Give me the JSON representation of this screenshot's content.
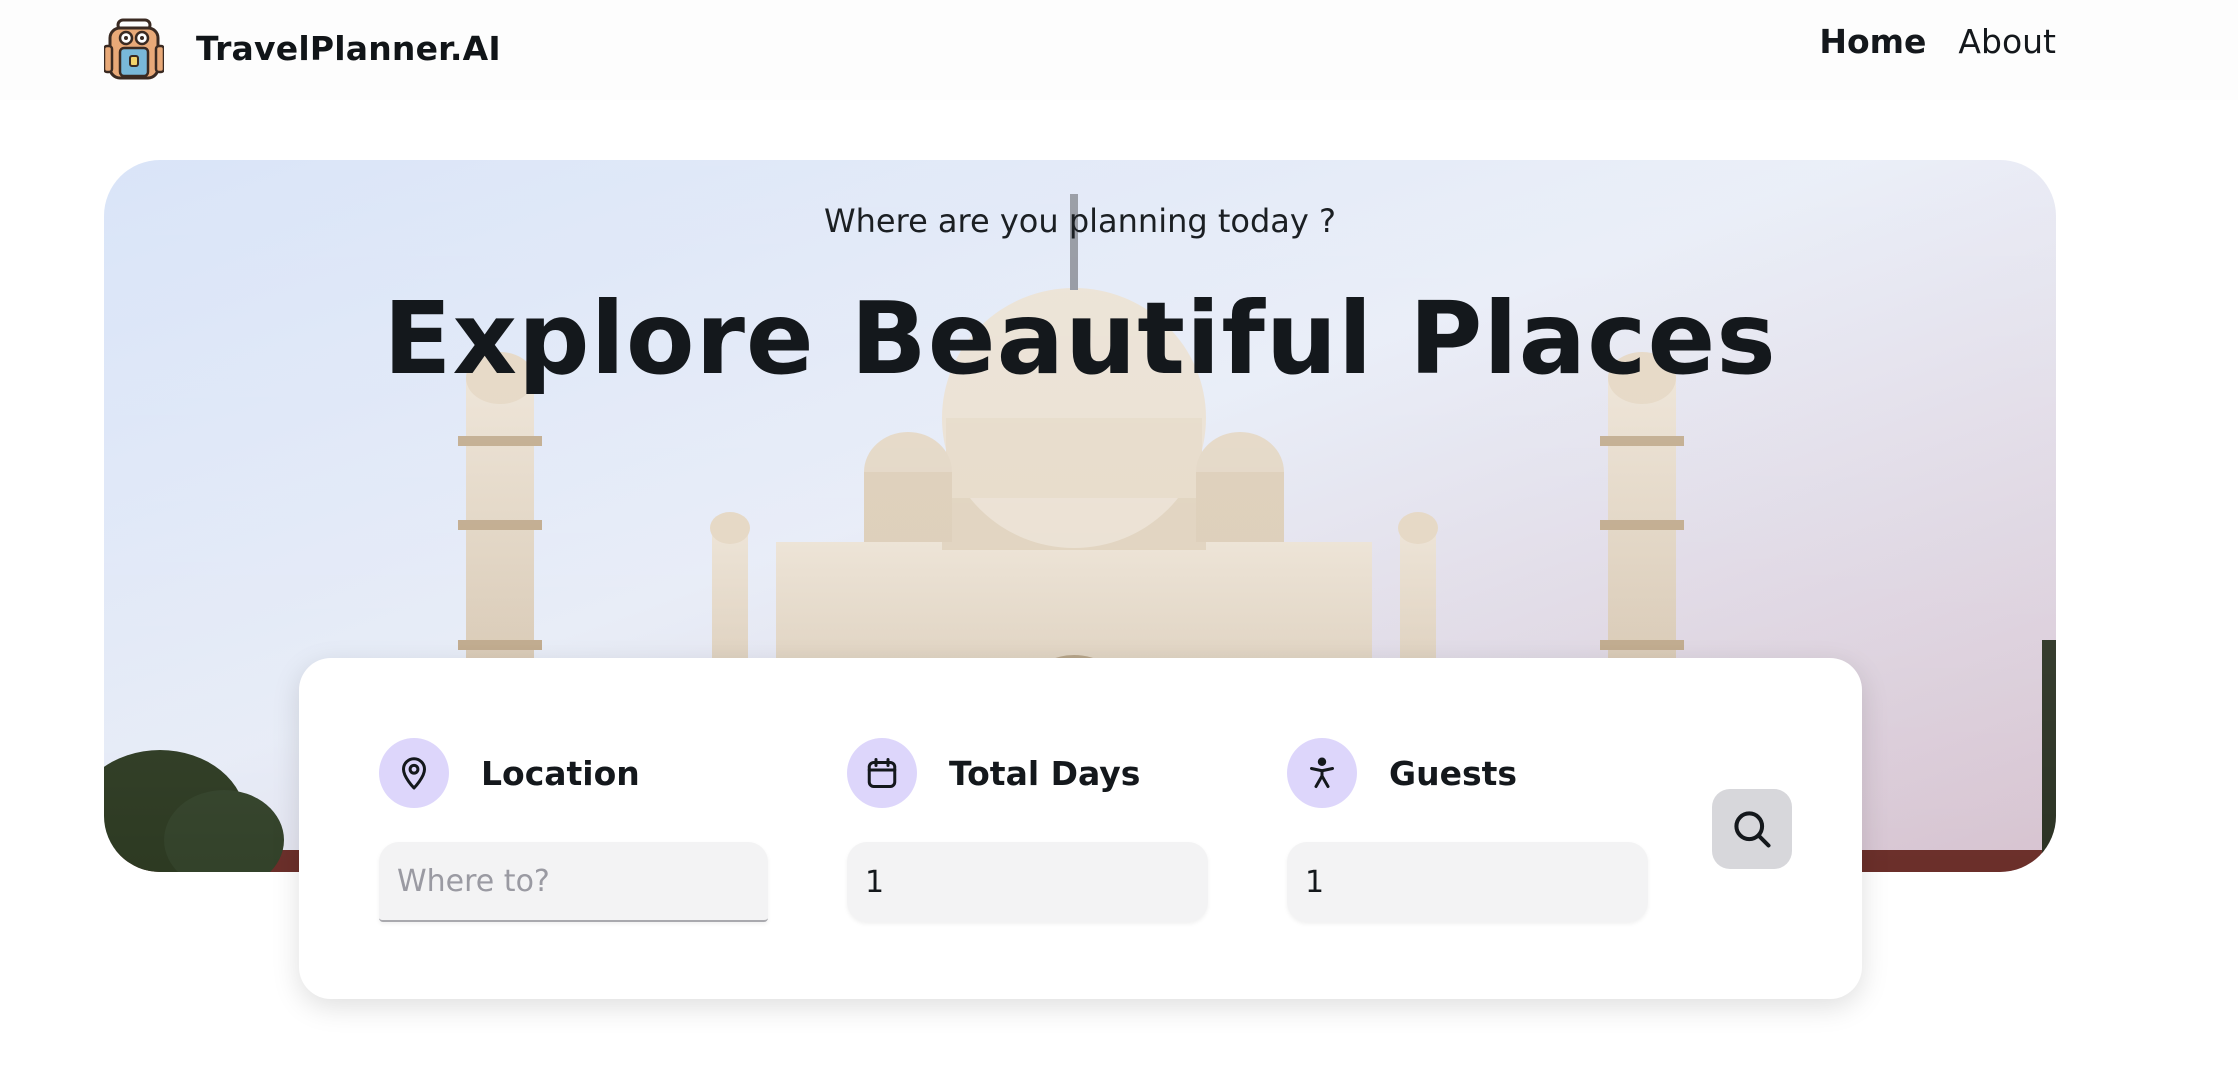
{
  "brand": {
    "name": "TravelPlanner.AI",
    "logo_icon": "backpack-icon"
  },
  "nav": {
    "items": [
      {
        "label": "Home",
        "active": true
      },
      {
        "label": "About",
        "active": false
      }
    ]
  },
  "hero": {
    "subtitle": "Where are you planning today ?",
    "title": "Explore Beautiful Places",
    "background": "taj-mahal-photo"
  },
  "search": {
    "location": {
      "label": "Location",
      "icon": "map-pin-icon",
      "placeholder": "Where to?",
      "value": ""
    },
    "days": {
      "label": "Total Days",
      "icon": "calendar-icon",
      "value": "1"
    },
    "guests": {
      "label": "Guests",
      "icon": "person-icon",
      "value": "1"
    },
    "button_icon": "search-icon"
  },
  "colors": {
    "icon_bg": "#ddd6fb",
    "input_bg": "#f3f3f4",
    "button_bg": "#d7d7db",
    "text": "#14181c"
  }
}
